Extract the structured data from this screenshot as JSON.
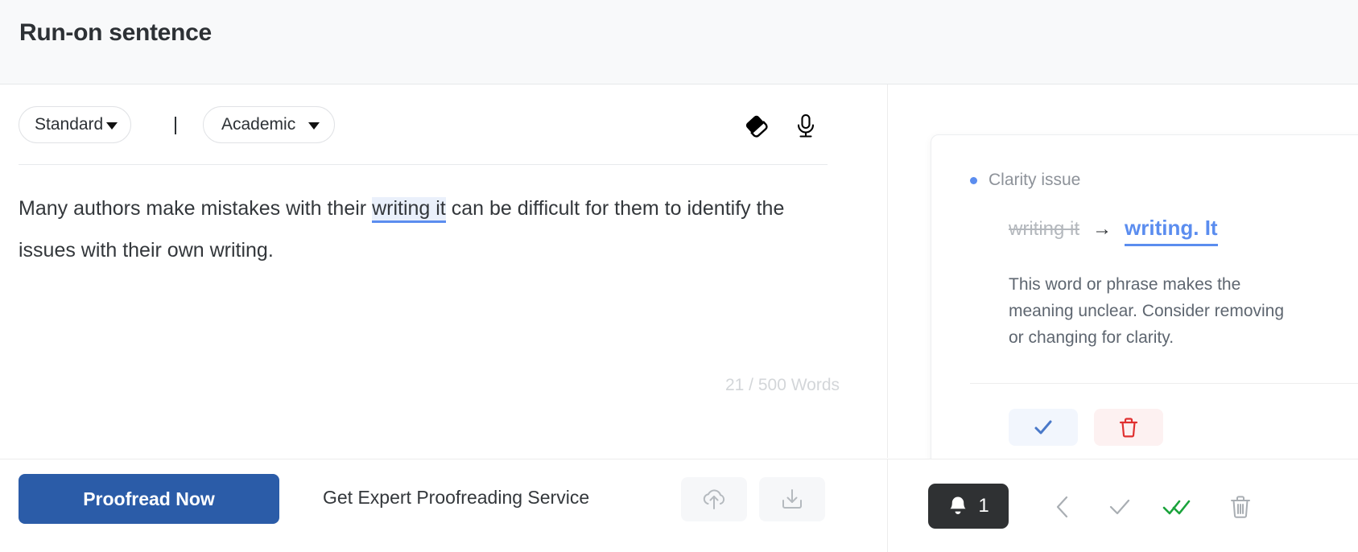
{
  "header": {
    "title": "Run-on sentence"
  },
  "toolbar": {
    "mode_label": "Standard",
    "style_label": "Academic",
    "separator": "|",
    "eraser_icon": "eraser-icon",
    "mic_icon": "microphone-icon"
  },
  "editor": {
    "text_before": "Many authors make mistakes with their ",
    "highlighted": "writing it",
    "text_after": " can be difficult for them to identify the issues with their own writing.",
    "word_count": "21 / 500 Words"
  },
  "suggestion": {
    "issue_label": "Clarity issue",
    "old_text": "writing it",
    "arrow": "→",
    "new_text": "writing. It",
    "description": "This word or phrase makes the meaning unclear. Consider removing or changing for clarity.",
    "accept_icon": "check-icon",
    "reject_icon": "trash-icon"
  },
  "bottom": {
    "proofread_label": "Proofread Now",
    "expert_label": "Get Expert Proofreading Service",
    "upload_icon": "cloud-upload-icon",
    "download_icon": "download-icon",
    "notification_count": "1",
    "bell_icon": "bell-icon",
    "prev_icon": "chevron-left-icon",
    "accept_icon": "check-icon",
    "accept_all_icon": "double-check-icon",
    "delete_icon": "trash-icon"
  },
  "colors": {
    "accent_blue": "#5b8def",
    "primary_button": "#2b5ca8",
    "highlight_bg": "#eaf0fb",
    "green_check": "#1aa33b",
    "reject_red": "#e03131",
    "badge_dark": "#2f3133"
  }
}
